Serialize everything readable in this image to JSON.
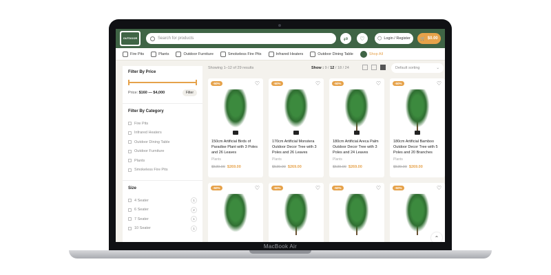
{
  "device_label": "MacBook Air",
  "header": {
    "logo_text": "OUTDOOR",
    "search_placeholder": "Search for products",
    "login_label": "Login / Register",
    "cart_total": "$0.00"
  },
  "categories": [
    {
      "label": "Fire Pits",
      "icon": "fire-pit-icon"
    },
    {
      "label": "Plants",
      "icon": "plant-icon"
    },
    {
      "label": "Outdoor Furniture",
      "icon": "furniture-icon"
    },
    {
      "label": "Smokeless Fire Pits",
      "icon": "smokeless-fire-pit-icon"
    },
    {
      "label": "Infrared Heaters",
      "icon": "heater-icon"
    },
    {
      "label": "Outdoor Dining Table",
      "icon": "dining-table-icon"
    },
    {
      "label": "Shop All",
      "icon": "shop-icon"
    }
  ],
  "sidebar": {
    "price_title": "Filter By Price",
    "price_label": "Price:",
    "price_range": "$160 — $4,000",
    "filter_button": "Filter",
    "category_title": "Filter By Category",
    "category_items": [
      "Fire Pits",
      "Infrared Heaters",
      "Outdoor Dining Table",
      "Outdoor Furniture",
      "Plants",
      "Smokeless Fire Pits"
    ],
    "size_title": "Size",
    "size_items": [
      {
        "label": "4 Seater",
        "count": "1"
      },
      {
        "label": "6 Seater",
        "count": "2"
      },
      {
        "label": "7 Seater",
        "count": "1"
      },
      {
        "label": "10 Seater",
        "count": "1"
      }
    ]
  },
  "toolbar": {
    "showing": "Showing 1–12 of 29 results",
    "show_label": "Show :",
    "show_options": [
      "9",
      "12",
      "18",
      "24"
    ],
    "show_selected": "12",
    "sort_label": "Default sorting"
  },
  "products": [
    {
      "badge": "-50%",
      "name": "150cm Artificial Birds of Paradise Plant with 3 Poles and 26 Leaves",
      "category": "Plants",
      "old_price": "$539.00",
      "price": "$269.00"
    },
    {
      "badge": "-50%",
      "name": "170cm Artificial Monstera Outdoor Decor Tree with 3 Poles and 26 Leaves",
      "category": "Plants",
      "old_price": "$539.00",
      "price": "$269.00"
    },
    {
      "badge": "-50%",
      "name": "180cm Artificial Areca Palm Outdoor Decor Tree with 3 Poles and 24 Leaves",
      "category": "Plants",
      "old_price": "$539.00",
      "price": "$269.00"
    },
    {
      "badge": "-50%",
      "name": "180cm Artificial Bamboo Outdoor Decor Tree with 5 Poles and 20 Branches",
      "category": "Plants",
      "old_price": "$539.00",
      "price": "$269.00"
    },
    {
      "badge": "-50%"
    },
    {
      "badge": "-50%"
    },
    {
      "badge": "-50%"
    },
    {
      "badge": "-50%"
    }
  ],
  "colors": {
    "brand_green": "#3f6445",
    "accent": "#e6a24a"
  }
}
